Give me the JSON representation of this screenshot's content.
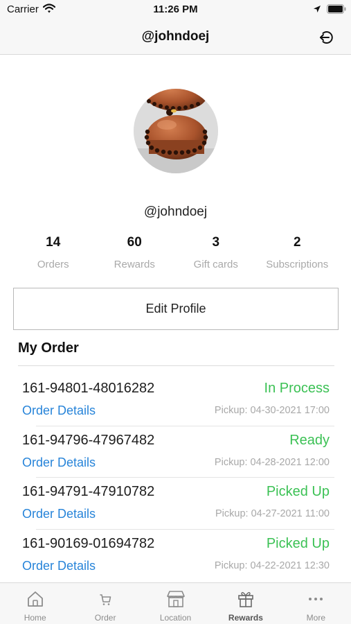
{
  "status_bar": {
    "carrier": "Carrier",
    "time": "11:26 PM"
  },
  "nav": {
    "title": "@johndoej",
    "logout_icon": "logout-icon"
  },
  "profile": {
    "username": "@johndoej",
    "stats": [
      {
        "value": "14",
        "label": "Orders"
      },
      {
        "value": "60",
        "label": "Rewards"
      },
      {
        "value": "3",
        "label": "Gift cards"
      },
      {
        "value": "2",
        "label": "Subscriptions"
      }
    ],
    "edit_button": "Edit Profile"
  },
  "orders": {
    "title": "My Order",
    "status_color": "#3bc154",
    "link_color": "#2784d9",
    "items": [
      {
        "number": "161-94801-48016282",
        "status": "In Process",
        "details": "Order Details",
        "pickup": "Pickup: 04-30-2021 17:00"
      },
      {
        "number": "161-94796-47967482",
        "status": "Ready",
        "details": "Order Details",
        "pickup": "Pickup: 04-28-2021 12:00"
      },
      {
        "number": "161-94791-47910782",
        "status": "Picked Up",
        "details": "Order Details",
        "pickup": "Pickup: 04-27-2021 11:00"
      },
      {
        "number": "161-90169-01694782",
        "status": "Picked Up",
        "details": "Order Details",
        "pickup": "Pickup: 04-22-2021 12:30"
      }
    ]
  },
  "tab_bar": {
    "items": [
      {
        "label": "Home",
        "icon": "home-icon"
      },
      {
        "label": "Order",
        "icon": "cart-icon"
      },
      {
        "label": "Location",
        "icon": "store-icon"
      },
      {
        "label": "Rewards",
        "icon": "gift-icon",
        "active": true
      },
      {
        "label": "More",
        "icon": "more-icon"
      }
    ]
  }
}
